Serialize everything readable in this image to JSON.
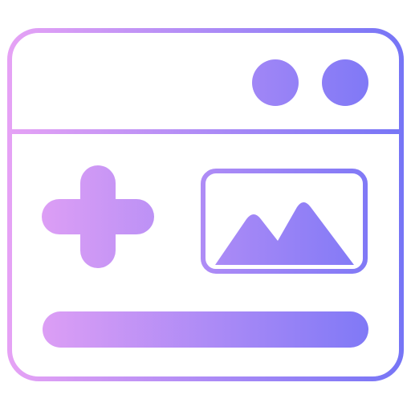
{
  "icon": {
    "name": "browser-add-image-icon",
    "gradient": {
      "start": "#e8a3f5",
      "end": "#7474f6"
    },
    "parts": [
      "window-frame",
      "title-bar-dots",
      "plus-sign",
      "image-placeholder",
      "text-bar"
    ]
  }
}
